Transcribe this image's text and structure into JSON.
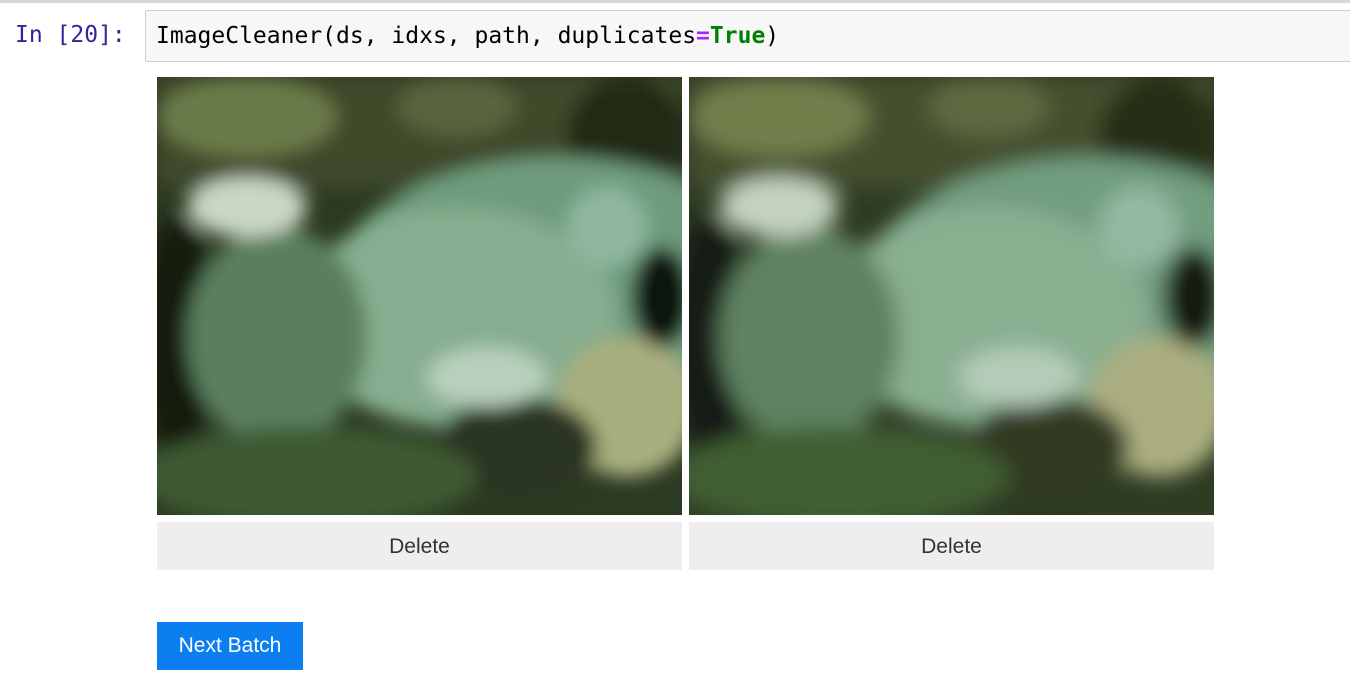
{
  "cell": {
    "prompt": "In [20]:",
    "code_before": "ImageCleaner(ds, idxs, path, duplicates",
    "code_op": "=",
    "code_kw": "True",
    "code_after": ")"
  },
  "images": [
    {
      "delete_label": "Delete"
    },
    {
      "delete_label": "Delete"
    }
  ],
  "next_batch_label": "Next Batch",
  "colors": {
    "prompt": "#3a1f9b",
    "keyword": "#008000",
    "operator": "#aa22ff",
    "next_button": "#0b7ef0",
    "delete_button": "#eeeeee"
  }
}
